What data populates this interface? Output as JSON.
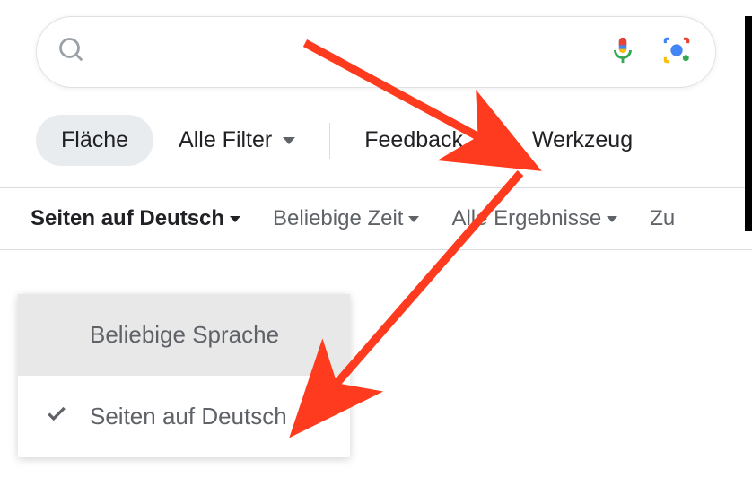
{
  "search": {
    "placeholder": ""
  },
  "chips": {
    "area": "Fläche",
    "allFilters": "Alle Filter",
    "feedback": "Feedback",
    "tools": "Werkzeug"
  },
  "tools": {
    "language": "Seiten auf Deutsch",
    "time": "Beliebige Zeit",
    "results": "Alle Ergebnisse",
    "reset": "Zu"
  },
  "dropdown": {
    "anyLanguage": "Beliebige Sprache",
    "germanPages": "Seiten auf Deutsch"
  }
}
